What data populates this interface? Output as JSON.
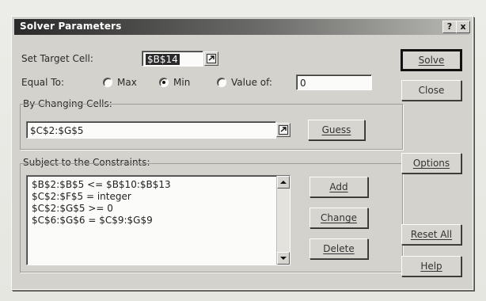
{
  "window": {
    "title": "Solver Parameters",
    "help_btn": "?",
    "close_btn": "x"
  },
  "target": {
    "label": "Set Target Cell:",
    "value": "$B$14"
  },
  "equal_to": {
    "label": "Equal To:",
    "options": [
      {
        "label": "Max",
        "selected": false
      },
      {
        "label": "Min",
        "selected": true
      },
      {
        "label": "Value of:",
        "selected": false
      }
    ],
    "value_of": "0"
  },
  "changing": {
    "label": "By Changing Cells:",
    "value": "$C$2:$G$5",
    "guess_label": "Guess"
  },
  "constraints": {
    "label": "Subject to the Constraints:",
    "items": [
      "$B$2:$B$5 <= $B$10:$B$13",
      "$C$2:$F$5 = integer",
      "$C$2:$G$5 >= 0",
      "$C$6:$G$6 = $C$9:$G$9"
    ],
    "add_label": "Add",
    "change_label": "Change",
    "delete_label": "Delete"
  },
  "side_buttons": {
    "solve": "Solve",
    "close": "Close",
    "options": "Options",
    "reset": "Reset All",
    "help": "Help"
  }
}
